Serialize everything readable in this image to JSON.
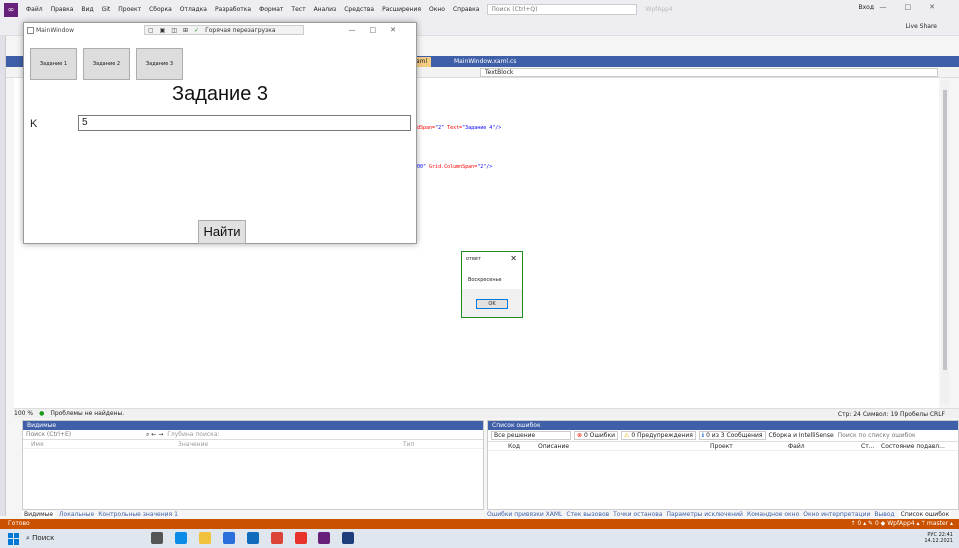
{
  "menubar": {
    "items": [
      "Файл",
      "Правка",
      "Вид",
      "Git",
      "Проект",
      "Сборка",
      "Отладка",
      "Разработка",
      "Формат",
      "Тест",
      "Анализ",
      "Средства",
      "Расширения",
      "Окно",
      "Справка"
    ],
    "search_placeholder": "Поиск (Ctrl+Q)",
    "project_name": "WpfApp4",
    "sign_in": "Вход",
    "window_controls": "—□✕"
  },
  "toolbar": {
    "live_share": "Live Share"
  },
  "editor": {
    "tab_active": "aml",
    "tab_other": "MainWindow.xaml.cs",
    "nav_dropdown": "TextBlock",
    "code_line1_attr": "dSpan=",
    "code_line1_val": "\"2\"",
    "code_line1_attr2": " Text=",
    "code_line1_val2": "\"Задание 4\"",
    "code_line1_end": "/>",
    "code_line2_val": "00\"",
    "code_line2_attr": " Grid.ColumnSpan=",
    "code_line2_val2": "\"2\"",
    "code_line2_end": "/>",
    "zoom": "100 %",
    "no_problems": "Проблемы не найдены.",
    "position": "Стр: 24   Символ: 19   Пробелы   CRLF"
  },
  "locals": {
    "title": "Видимые",
    "search_placeholder": "Поиск (Ctrl+E)",
    "depth_label": "Глубина поиска:",
    "col_name": "Имя",
    "col_value": "Значение",
    "col_type": "Тип",
    "tabs": [
      "Видимые",
      "Локальные",
      "Контрольные значения 1"
    ]
  },
  "errors": {
    "title": "Список ошибок",
    "scope": "Все решение",
    "errors_count": "0 Ошибки",
    "warnings_count": "0 Предупреждения",
    "messages_count": "0 из 3 Сообщения",
    "build_filter": "Сборка и IntelliSense",
    "search_placeholder": "Поиск по списку ошибок",
    "col_code": "Код",
    "col_desc": "Описание",
    "col_project": "Проект",
    "col_file": "Файл",
    "col_line": "Ст...",
    "col_state": "Состояние подавл...",
    "tabs": [
      "Ошибки привязки XAML",
      "Стек вызовов",
      "Точки останова",
      "Параметры исключений",
      "Командное окно",
      "Окно интерпретации",
      "Вывод",
      "Список ошибок"
    ]
  },
  "vs_status": {
    "ready": "Готово",
    "right": "↑ 0 ▴   ✎ 0   ◆ WpfApp4 ▴   ᛘ master ▴"
  },
  "taskbar": {
    "search": "Поиск",
    "lang": "РУС",
    "time": "22:41",
    "date": "14.12.2021"
  },
  "wpf_window": {
    "title": "MainWindow",
    "hot_reload": "Горячая перезагрузка",
    "tab_buttons": [
      "Задание 1",
      "Задание 2",
      "Задание 3"
    ],
    "heading": "Задание 3",
    "k_label": "K",
    "k_value": "5",
    "find_button": "Найти",
    "window_controls": "—□✕"
  },
  "message_box": {
    "title": "ответ",
    "message": "Воскресенье",
    "ok_button": "OK"
  }
}
